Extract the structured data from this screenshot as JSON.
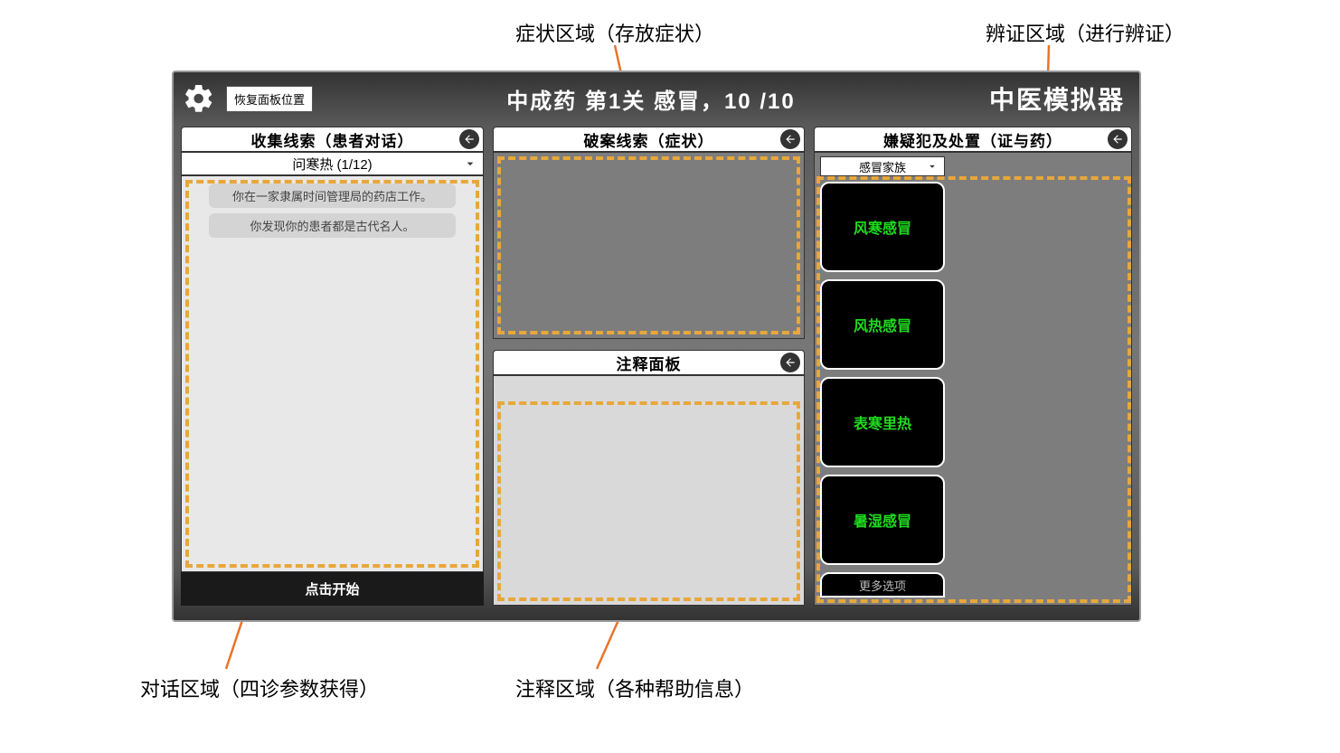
{
  "annotations": {
    "top_symptom": "症状区域（存放症状）",
    "top_diagnosis": "辨证区域（进行辨证）",
    "bottom_dialog": "对话区域（四诊参数获得）",
    "bottom_notes": "注释区域（各种帮助信息）"
  },
  "topbar": {
    "reset_label": "恢复面板位置",
    "level_info": "中成药  第1关  感冒，10 /10",
    "app_title": "中医模拟器"
  },
  "dialog_panel": {
    "header": "收集线索（患者对话）",
    "sub_header": "问寒热 (1/12)",
    "chat_1": "你在一家隶属时间管理局的药店工作。",
    "chat_2": "你发现你的患者都是古代名人。",
    "start_label": "点击开始"
  },
  "symptom_panel": {
    "header": "破案线索（症状）"
  },
  "notes_panel": {
    "header": "注释面板"
  },
  "diagnosis_panel": {
    "header": "嫌疑犯及处置（证与药）",
    "family_label": "感冒家族",
    "cards": [
      "风寒感冒",
      "风热感冒",
      "表寒里热",
      "暑湿感冒"
    ],
    "more_label": "更多选项"
  }
}
